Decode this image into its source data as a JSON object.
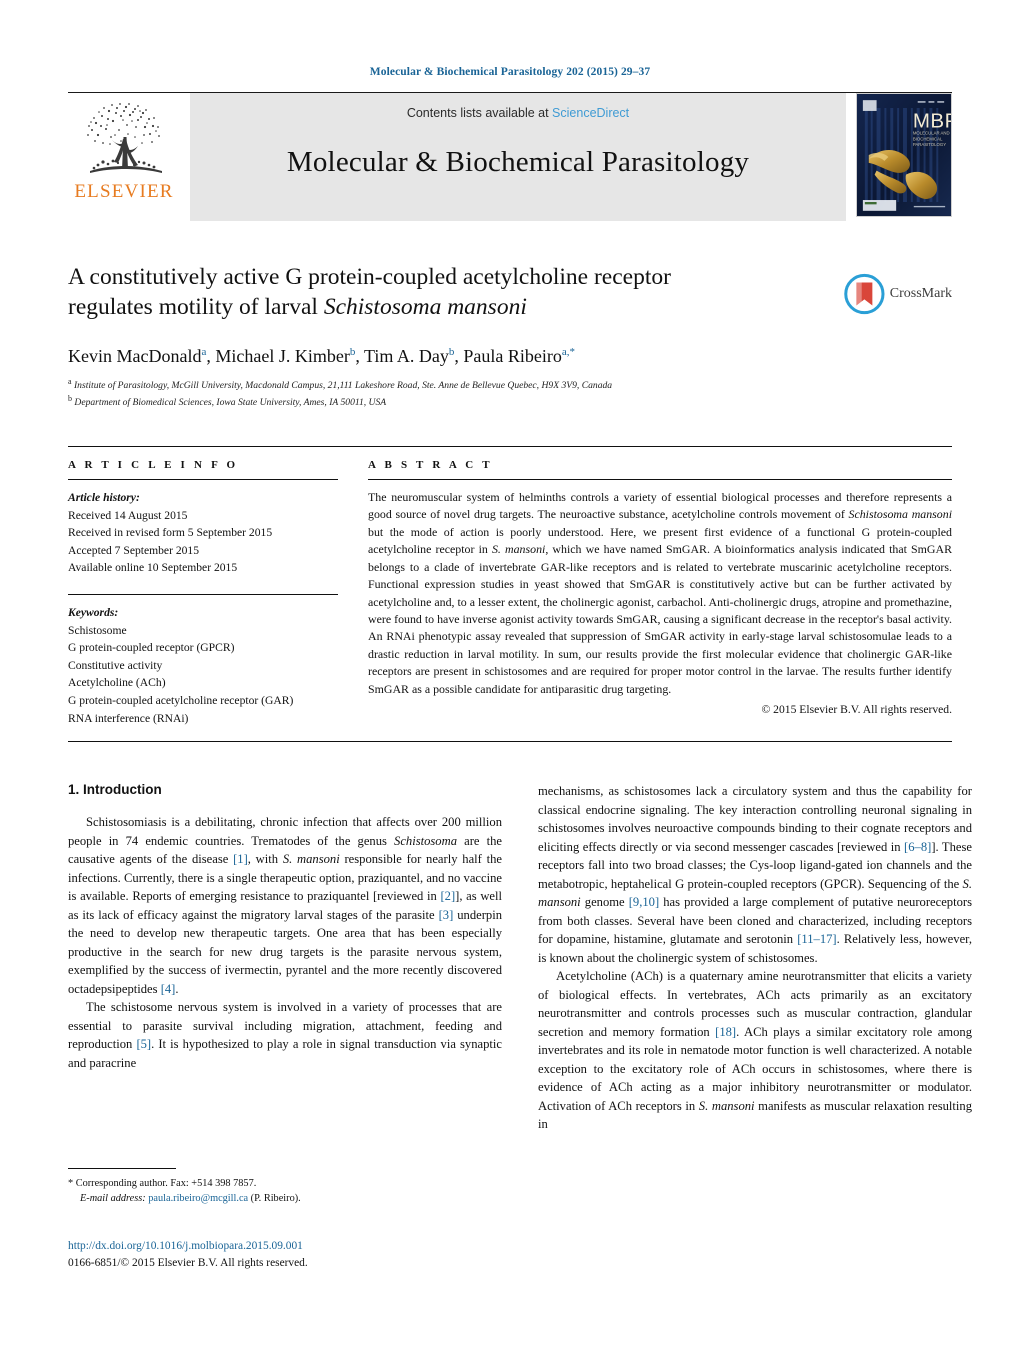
{
  "running_head": "Molecular & Biochemical Parasitology 202 (2015) 29–37",
  "masthead": {
    "publisher_name": "ELSEVIER",
    "contents_prefix": "Contents lists available at ",
    "contents_link": "ScienceDirect",
    "journal_title": "Molecular & Biochemical Parasitology",
    "cover_acronym": "MBP",
    "cover_subtitle": "MOLECULAR AND BIOCHEMICAL PARASITOLOGY"
  },
  "article": {
    "title_line1": "A constitutively active G protein-coupled acetylcholine receptor",
    "title_line2_plain": "regulates motility of larval ",
    "title_line2_italic": "Schistosoma mansoni",
    "crossmark_label": "CrossMark",
    "authors": [
      {
        "name": "Kevin MacDonald",
        "sup": "a"
      },
      {
        "name": "Michael J. Kimber",
        "sup": "b"
      },
      {
        "name": "Tim A. Day",
        "sup": "b"
      },
      {
        "name": "Paula Ribeiro",
        "sup": "a,*"
      }
    ],
    "affiliations": [
      {
        "marker": "a",
        "text": "Institute of Parasitology, McGill University, Macdonald Campus, 21,111 Lakeshore Road, Ste. Anne de Bellevue Quebec, H9X 3V9, Canada"
      },
      {
        "marker": "b",
        "text": "Department of Biomedical Sciences, Iowa State University, Ames, IA 50011, USA"
      }
    ]
  },
  "article_info": {
    "heading": "A R T I C L E   I N F O",
    "history_label": "Article history:",
    "history": [
      "Received 14 August 2015",
      "Received in revised form 5 September 2015",
      "Accepted 7 September 2015",
      "Available online 10 September 2015"
    ],
    "keywords_label": "Keywords:",
    "keywords": [
      "Schistosome",
      "G protein-coupled receptor (GPCR)",
      "Constitutive activity",
      "Acetylcholine (ACh)",
      "G protein-coupled acetylcholine receptor (GAR)",
      "RNA interference (RNAi)"
    ]
  },
  "abstract": {
    "heading": "A B S T R A C T",
    "part1": "The neuromuscular system of helminths controls a variety of essential biological processes and therefore represents a good source of novel drug targets. The neuroactive substance, acetylcholine controls movement of ",
    "italic1": "Schistosoma mansoni",
    "part2": " but the mode of action is poorly understood. Here, we present first evidence of a functional G protein-coupled acetylcholine receptor in ",
    "italic2": "S. mansoni",
    "part3": ", which we have named SmGAR. A bioinformatics analysis indicated that SmGAR belongs to a clade of invertebrate GAR-like receptors and is related to vertebrate muscarinic acetylcholine receptors. Functional expression studies in yeast showed that SmGAR is constitutively active but can be further activated by acetylcholine and, to a lesser extent, the cholinergic agonist, carbachol. Anti-cholinergic drugs, atropine and promethazine, were found to have inverse agonist activity towards SmGAR, causing a significant decrease in the receptor's basal activity. An RNAi phenotypic assay revealed that suppression of SmGAR activity in early-stage larval schistosomulae leads to a drastic reduction in larval motility. In sum, our results provide the first molecular evidence that cholinergic GAR-like receptors are present in schistosomes and are required for proper motor control in the larvae. The results further identify SmGAR as a possible candidate for antiparasitic drug targeting.",
    "copyright": "© 2015 Elsevier B.V. All rights reserved."
  },
  "body": {
    "section_number_title": "1.  Introduction",
    "left": {
      "p1_a": "Schistosomiasis is a debilitating, chronic infection that affects over 200 million people in 74 endemic countries. Trematodes of the genus ",
      "p1_i1": "Schistosoma",
      "p1_b": " are the causative agents of the disease ",
      "p1_r1": "[1]",
      "p1_c": ", with ",
      "p1_i2": "S. mansoni",
      "p1_d": " responsible for nearly half the infections. Currently, there is a single therapeutic option, praziquantel, and no vaccine is available. Reports of emerging resistance to praziquantel [reviewed in ",
      "p1_r2": "[2]",
      "p1_e": "], as well as its lack of efficacy against the migratory larval stages of the parasite ",
      "p1_r3": "[3]",
      "p1_f": " underpin the need to develop new therapeutic targets. One area that has been especially productive in the search for new drug targets is the parasite nervous system, exemplified by the success of ivermectin, pyrantel and the more recently discovered octadepsipeptides ",
      "p1_r4": "[4]",
      "p1_g": ".",
      "p2_a": "The schistosome nervous system is involved in a variety of processes that are essential to parasite survival including migration, attachment, feeding and reproduction ",
      "p2_r1": "[5]",
      "p2_b": ". It is hypothesized to play a role in signal transduction via synaptic and paracrine"
    },
    "right": {
      "p1_a": "mechanisms, as schistosomes lack a circulatory system and thus the capability for classical endocrine signaling. The key interaction controlling neuronal signaling in schistosomes involves neuroactive compounds binding to their cognate receptors and eliciting effects directly or via second messenger cascades [reviewed in ",
      "p1_r1": "[6–8]",
      "p1_b": "]. These receptors fall into two broad classes; the Cys-loop ligand-gated ion channels and the metabotropic, heptahelical G protein-coupled receptors (GPCR). Sequencing of the ",
      "p1_i1": "S. mansoni",
      "p1_c": " genome ",
      "p1_r2": "[9,10]",
      "p1_d": " has provided a large complement of putative neuroreceptors from both classes. Several have been cloned and characterized, including receptors for dopamine, histamine, glutamate and serotonin ",
      "p1_r3": "[11–17]",
      "p1_e": ". Relatively less, however, is known about the cholinergic system of schistosomes.",
      "p2_a": "Acetylcholine (ACh) is a quaternary amine neurotransmitter that elicits a variety of biological effects. In vertebrates, ACh acts primarily as an excitatory neurotransmitter and controls processes such as muscular contraction, glandular secretion and memory formation ",
      "p2_r1": "[18]",
      "p2_b": ". ACh plays a similar excitatory role among invertebrates and its role in nematode motor function is well characterized. A notable exception to the excitatory role of ACh occurs in schistosomes, where there is evidence of ACh acting as a major inhibitory neurotransmitter or modulator. Activation of ACh receptors in ",
      "p2_i1": "S. mansoni",
      "p2_c": " manifests as muscular relaxation resulting in"
    }
  },
  "footer": {
    "corresponding_marker": "*",
    "corresponding_text": "Corresponding author. Fax: +514 398 7857.",
    "email_label": "E-mail address:",
    "email": "paula.ribeiro@mcgill.ca",
    "email_suffix": " (P. Ribeiro).",
    "doi": "http://dx.doi.org/10.1016/j.molbiopara.2015.09.001",
    "issn_line": "0166-6851/© 2015 Elsevier B.V. All rights reserved."
  },
  "colors": {
    "link_blue": "#1a6496",
    "sciencedirect_blue": "#3f9bd4",
    "elsevier_orange": "#E77B20",
    "band_grey": "#e6e6e6"
  }
}
